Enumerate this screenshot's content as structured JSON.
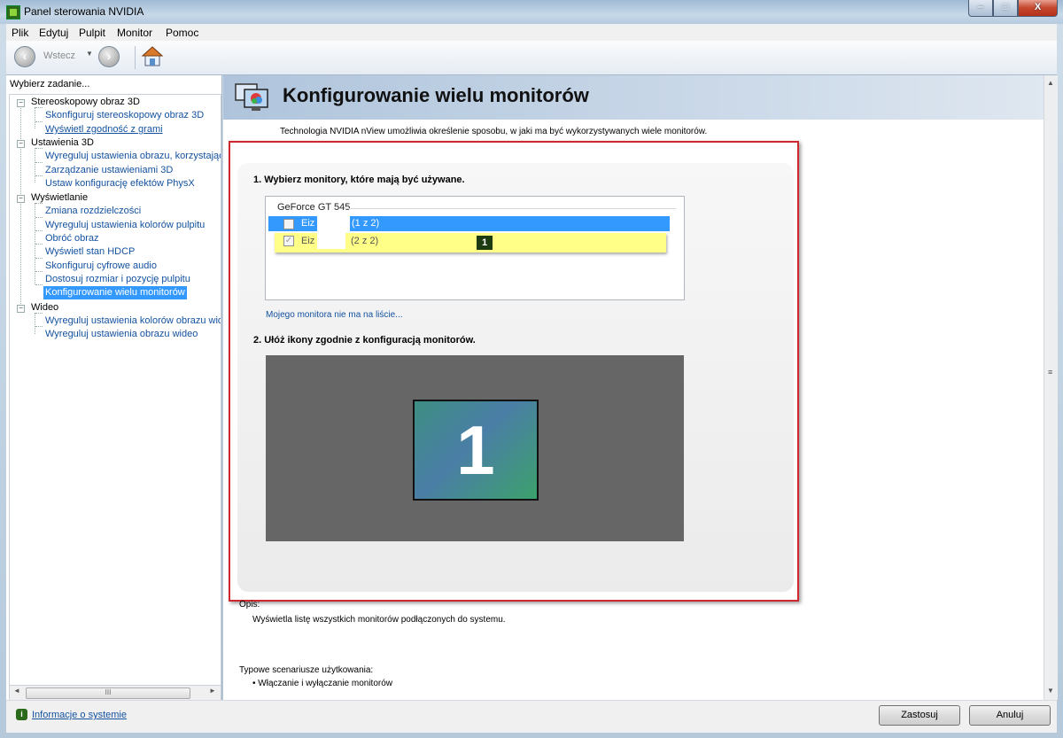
{
  "window": {
    "title": "Panel sterowania NVIDIA",
    "controls": {
      "minimize": "–",
      "maximize": "□",
      "close": "X"
    }
  },
  "menu": [
    "Plik",
    "Edytuj",
    "Pulpit",
    "Monitor",
    "Pomoc"
  ],
  "toolbar": {
    "back_label": "Wstecz"
  },
  "sidebar": {
    "header": "Wybierz zadanie...",
    "tree": [
      {
        "label": "Stereoskopowy obraz 3D",
        "children": [
          "Skonfiguruj stereoskopowy obraz 3D",
          "Wyświetl zgodność z grami"
        ]
      },
      {
        "label": "Ustawienia 3D",
        "children": [
          "Wyreguluj ustawienia obrazu, korzystając z",
          "Zarządzanie ustawieniami 3D",
          "Ustaw konfigurację efektów PhysX"
        ]
      },
      {
        "label": "Wyświetlanie",
        "children": [
          "Zmiana rozdzielczości",
          "Wyreguluj ustawienia kolorów pulpitu",
          "Obróć obraz",
          "Wyświetl stan HDCP",
          "Skonfiguruj cyfrowe audio",
          "Dostosuj rozmiar i pozycję pulpitu",
          "Konfigurowanie wielu monitorów"
        ]
      },
      {
        "label": "Wideo",
        "children": [
          "Wyreguluj ustawienia kolorów obrazu wideo",
          "Wyreguluj ustawienia obrazu wideo"
        ]
      }
    ],
    "selected": "Konfigurowanie wielu monitorów",
    "scroll_grip": "III",
    "system_info": "Informacje o systemie"
  },
  "main": {
    "title": "Konfigurowanie wielu monitorów",
    "description": "Technologia NVIDIA nView umożliwia określenie sposobu, w jaki ma być wykorzystywanych wiele monitorów.",
    "step1": "1. Wybierz monitory, które mają być używane.",
    "gpu": "GeForce GT 545",
    "monitors": [
      {
        "prefix": "Eiz",
        "suffix": "(1 z 2)",
        "checked": false,
        "selected": true
      },
      {
        "prefix": "Eiz",
        "suffix": "(2 z 2)",
        "checked": true,
        "selected": false,
        "badge": "1"
      }
    ],
    "not_listed_link": "Mojego monitora nie ma na liście...",
    "step2": "2. Ułóż ikony zgodnie z konfiguracją monitorów.",
    "arrangement_monitor": "1",
    "description_label": "Opis:",
    "description_text": "Wyświetla listę wszystkich monitorów podłączonych do systemu.",
    "scenarios_label": "Typowe scenariusze użytkowania:",
    "scenarios": [
      "Włączanie i wyłączanie monitorów"
    ]
  },
  "buttons": {
    "apply": "Zastosuj",
    "cancel": "Anuluj"
  },
  "colors": {
    "selection": "#3399ff",
    "highlight": "#ffff88",
    "frame": "#d0262f",
    "badge": "#1d3b10"
  }
}
